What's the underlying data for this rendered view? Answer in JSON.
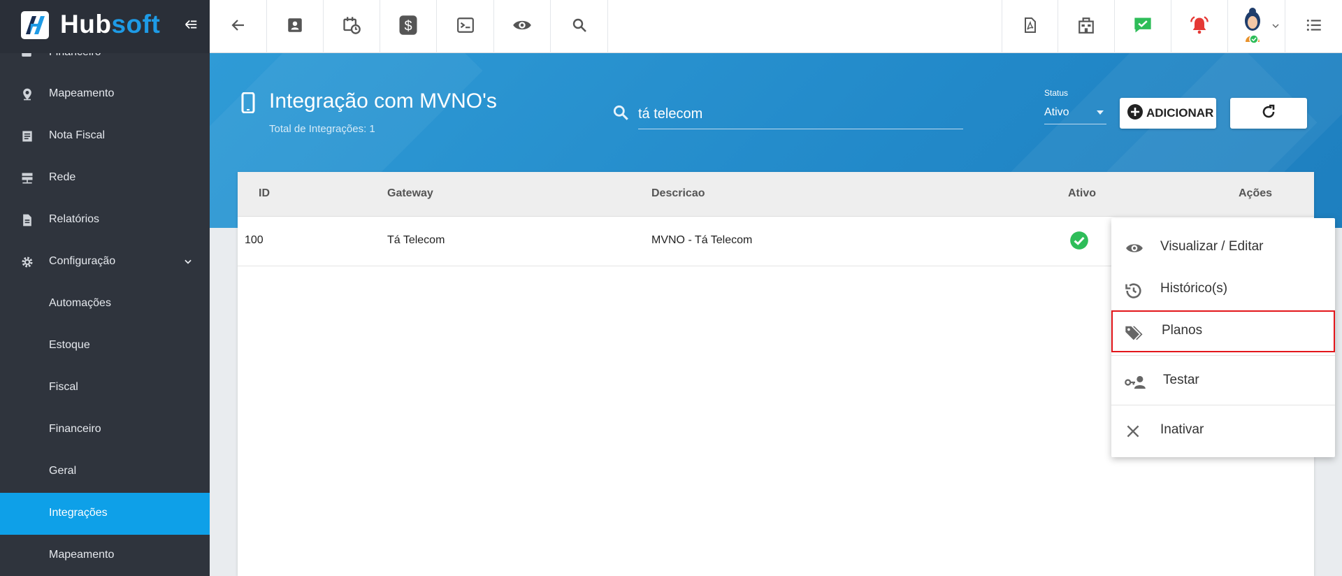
{
  "brand": {
    "part1": "Hub",
    "part2": "soft"
  },
  "sidebar": {
    "items": [
      {
        "label": "Financeiro"
      },
      {
        "label": "Mapeamento"
      },
      {
        "label": "Nota Fiscal"
      },
      {
        "label": "Rede"
      },
      {
        "label": "Relatórios"
      },
      {
        "label": "Configuração"
      },
      {
        "label": "Automações"
      },
      {
        "label": "Estoque"
      },
      {
        "label": "Fiscal"
      },
      {
        "label": "Financeiro"
      },
      {
        "label": "Geral"
      },
      {
        "label": "Integrações"
      },
      {
        "label": "Mapeamento"
      }
    ],
    "active": "Integrações"
  },
  "header": {
    "title": "Integração com MVNO's",
    "subtitle": "Total de Integrações: 1",
    "search_value": "tá telecom",
    "status_label": "Status",
    "status_value": "Ativo",
    "add_label": "ADICIONAR"
  },
  "table": {
    "columns": [
      "ID",
      "Gateway",
      "Descricao",
      "Ativo",
      "Ações"
    ],
    "rows": [
      {
        "id": "100",
        "gateway": "Tá Telecom",
        "descricao": "MVNO - Tá Telecom",
        "ativo": true
      }
    ]
  },
  "menu": {
    "items": [
      {
        "label": "Visualizar / Editar",
        "icon": "eye-icon"
      },
      {
        "label": "Histórico(s)",
        "icon": "history-icon"
      },
      {
        "label": "Planos",
        "icon": "tags-icon"
      },
      {
        "label": "Testar",
        "icon": "key-user-icon"
      },
      {
        "label": "Inativar",
        "icon": "close-icon"
      }
    ],
    "highlighted": "Planos"
  },
  "colors": {
    "sidebar_bg": "#2f343d",
    "active_item": "#0ea0e8",
    "header_blue": "#2289c9",
    "success_green": "#2ebd59",
    "alert_red": "#e53935",
    "highlight_border": "#e3161b"
  }
}
